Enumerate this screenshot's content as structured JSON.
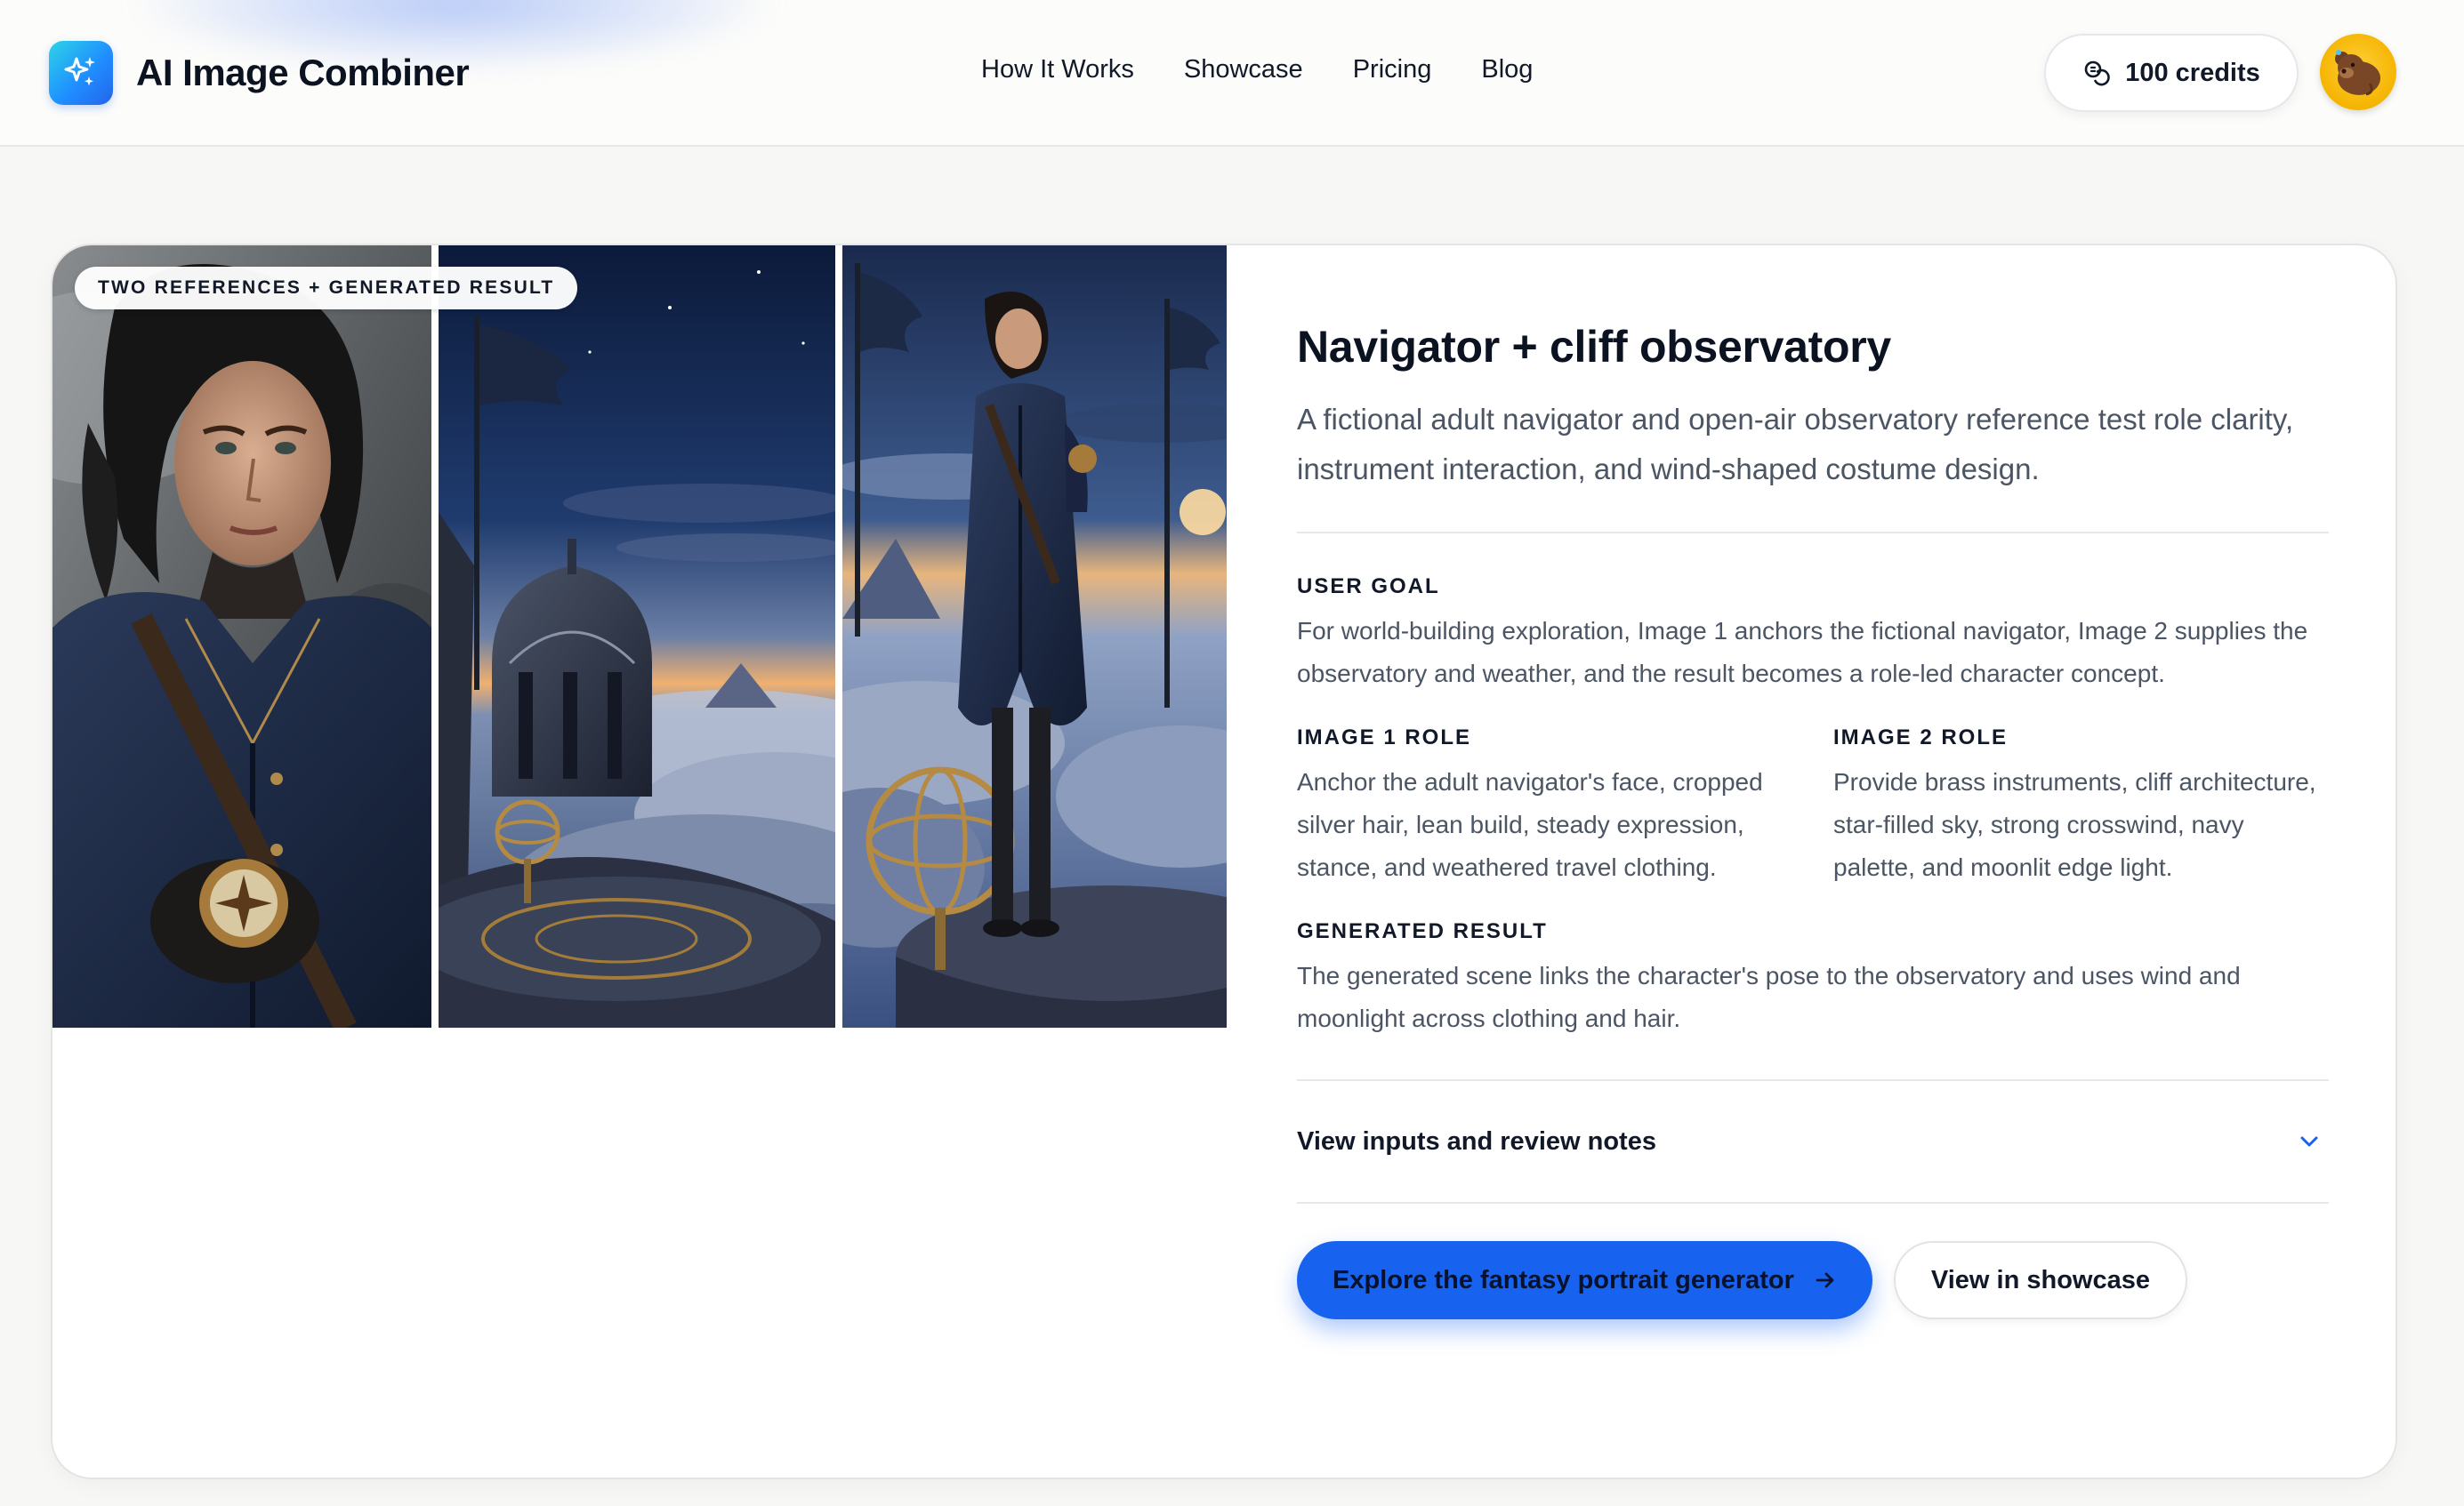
{
  "header": {
    "brand_name": "AI Image Combiner",
    "nav": [
      "How It Works",
      "Showcase",
      "Pricing",
      "Blog"
    ],
    "credits_label": "100 credits"
  },
  "example": {
    "media_badge": "TWO REFERENCES + GENERATED RESULT",
    "image_alts": [
      "Navigator reference portrait",
      "Cliff observatory reference scene",
      "Generated navigator at the observatory"
    ],
    "title": "Navigator + cliff observatory",
    "subtitle": "A fictional adult navigator and open-air observatory reference test role clarity, instrument interaction, and wind-shaped costume design.",
    "user_goal": {
      "label": "USER GOAL",
      "text": "For world-building exploration, Image 1 anchors the fictional navigator, Image 2 supplies the observatory and weather, and the result becomes a role-led character concept."
    },
    "image1_role": {
      "label": "IMAGE 1 ROLE",
      "text": "Anchor the adult navigator's face, cropped silver hair, lean build, steady expression, stance, and weathered travel clothing."
    },
    "image2_role": {
      "label": "IMAGE 2 ROLE",
      "text": "Provide brass instruments, cliff architecture, star-filled sky, strong crosswind, navy palette, and moonlit edge light."
    },
    "generated_result": {
      "label": "GENERATED RESULT",
      "text": "The generated scene links the character's pose to the observatory and uses wind and moonlight across clothing and hair."
    },
    "accordion_label": "View inputs and review notes",
    "primary_button": "Explore the fantasy portrait generator",
    "secondary_button": "View in showcase"
  },
  "colors": {
    "accent": "#1763f0",
    "brand_gradient_start": "#2dd4e6",
    "brand_gradient_end": "#2563eb",
    "avatar_bg": "#f5b400"
  },
  "icons": {
    "brand": "sparkle-icon",
    "credits": "coins-icon",
    "avatar": "bear-avatar-icon",
    "accordion": "chevron-down-icon",
    "primary_button": "arrow-right-icon"
  }
}
